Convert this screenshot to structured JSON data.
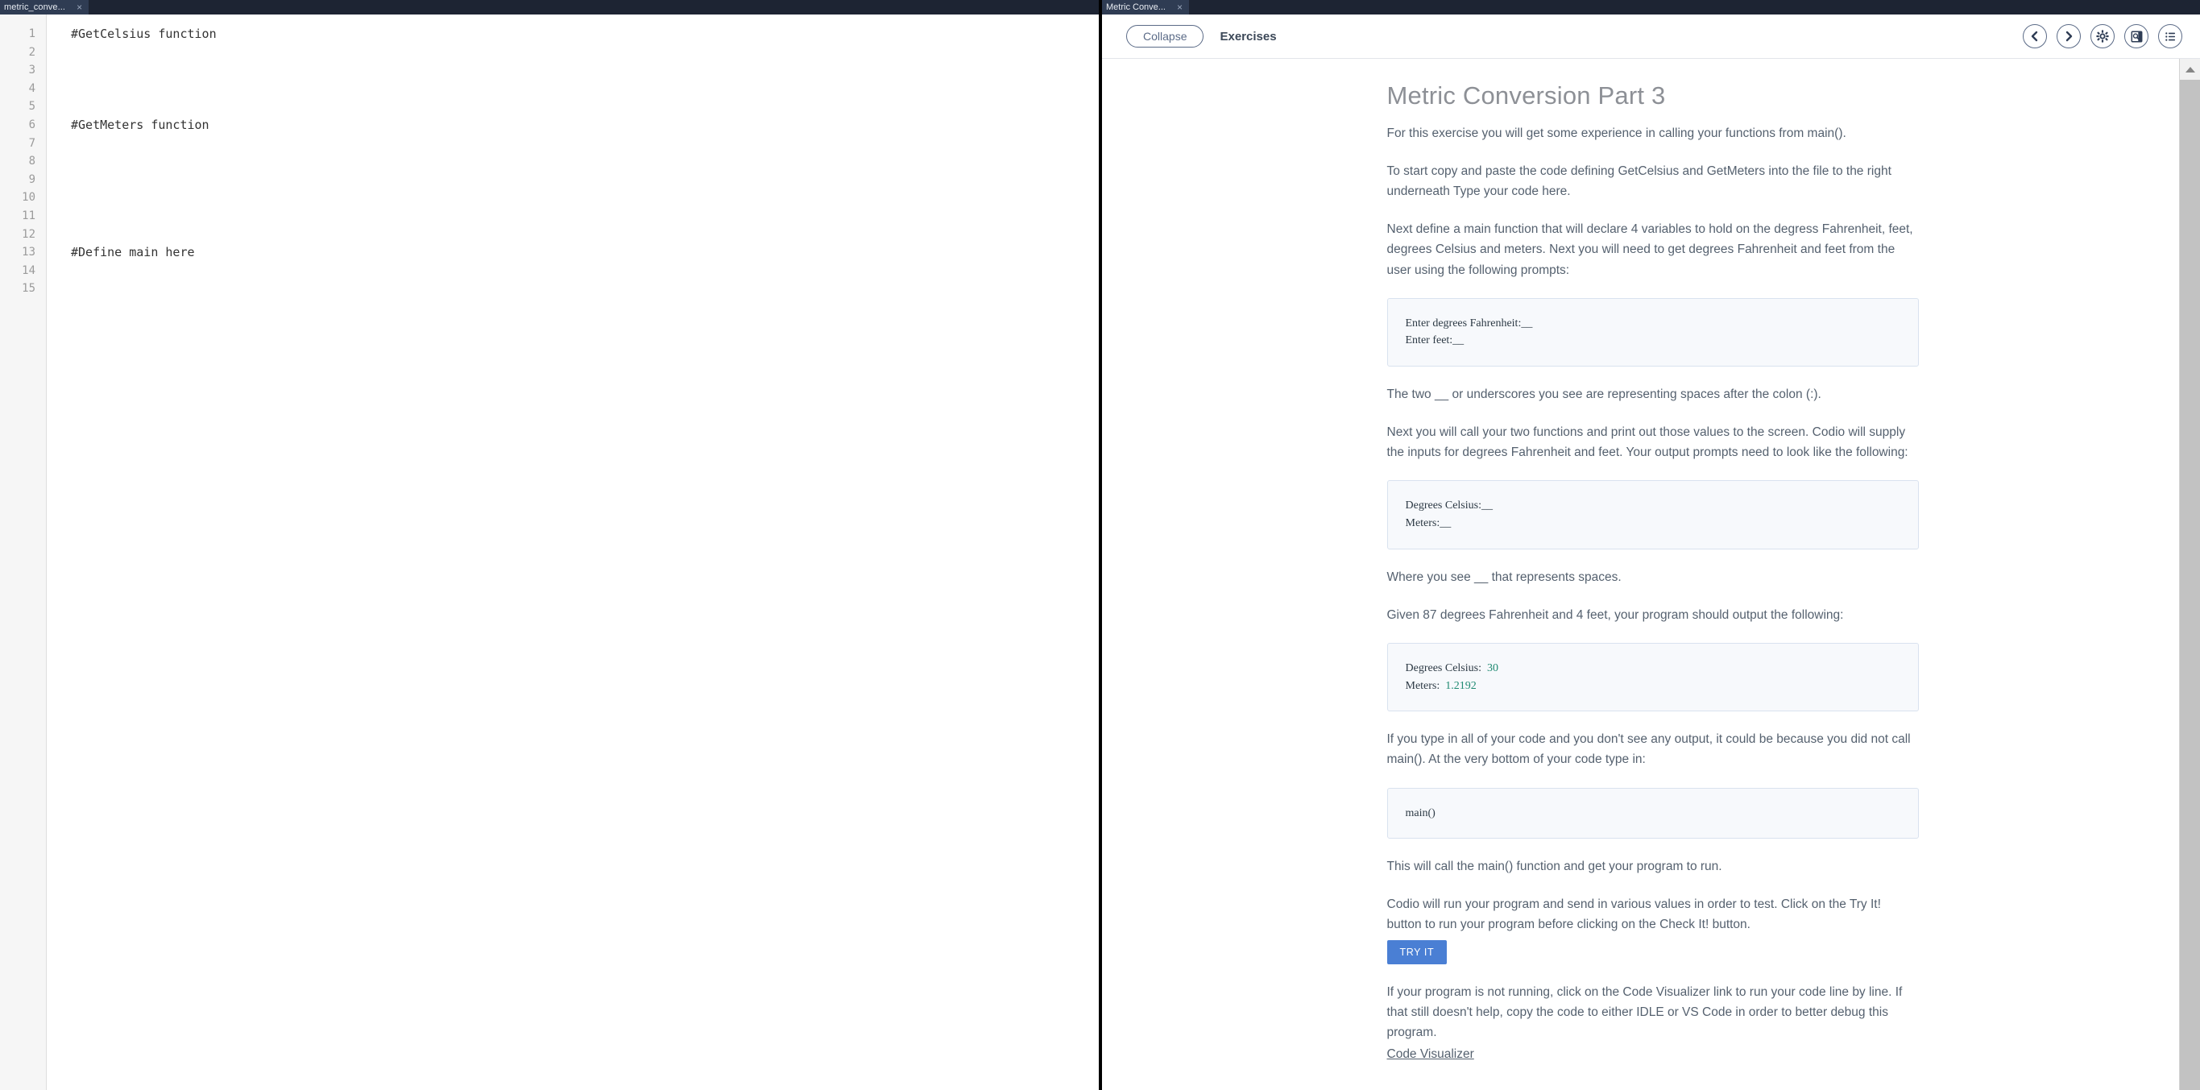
{
  "editor": {
    "tab": {
      "title": "metric_conve...",
      "close": "×"
    },
    "line_numbers": [
      "1",
      "2",
      "3",
      "4",
      "5",
      "6",
      "7",
      "8",
      "9",
      "10",
      "11",
      "12",
      "13",
      "14",
      "15"
    ],
    "lines": [
      "#GetCelsius function",
      "",
      "",
      "",
      "",
      "#GetMeters function",
      "",
      "",
      "",
      "",
      "",
      "",
      "#Define main here",
      "",
      ""
    ],
    "comment_color": "#c97c2b"
  },
  "guide": {
    "tab": {
      "title": "Metric Conve...",
      "close": "×"
    },
    "toolbar": {
      "collapse_label": "Collapse",
      "title": "Exercises",
      "icons": [
        "prev-icon",
        "next-icon",
        "gear-icon",
        "page-search-icon",
        "table-of-contents-icon"
      ]
    },
    "title": "Metric Conversion Part 3",
    "paragraphs": {
      "p1": "For this exercise you will get some experience in calling your functions from main().",
      "p2": "To start copy and paste the code defining GetCelsius and GetMeters into the file to the right underneath Type your code here.",
      "p3": "Next define a main function that will declare 4 variables to hold on the degress Fahrenheit, feet, degrees Celsius and meters. Next you will need to get degrees Fahrenheit and feet from the user using the following prompts:",
      "p4": "The two __ or underscores you see are representing spaces after the colon (:).",
      "p5": "Next you will call your two functions and print out those values to the screen. Codio will supply the inputs for degrees Fahrenheit and feet. Your output prompts need to look like the following:",
      "p6": "Where you see __ that represents spaces.",
      "p7": "Given 87 degrees Fahrenheit and 4 feet, your program should output the following:",
      "p8": "If you type in all of your code and you don't see any output, it could be because you did not call main(). At the very bottom of your code type in:",
      "p9": "This will call the main() function and get your program to run.",
      "p10": "Codio will run your program and send in various values in order to test. Click on the Try It! button to run your program before clicking on the Check It! button.",
      "p11": "If your program is not running, click on the Code Visualizer link to run your code line by line. If that still doesn't help, copy the code to either IDLE or VS Code in order to better debug this program."
    },
    "code_blocks": {
      "prompts": {
        "line1": "Enter degrees Fahrenheit:__",
        "line2": "Enter feet:__"
      },
      "outputs": {
        "line1": "Degrees Celsius:__",
        "line2": "Meters:__"
      },
      "example": {
        "label1": "Degrees Celsius:",
        "value1": "30",
        "label2": "Meters:",
        "value2": "1.2192",
        "value_color": "#1f8a72"
      },
      "maincall": {
        "line1": "main()"
      }
    },
    "try_it_label": "TRY IT",
    "try_it_color": "#4a7fd4",
    "code_visualizer_link": "Code Visualizer"
  },
  "scrollbar": {
    "arrow_up": "up-arrow"
  }
}
